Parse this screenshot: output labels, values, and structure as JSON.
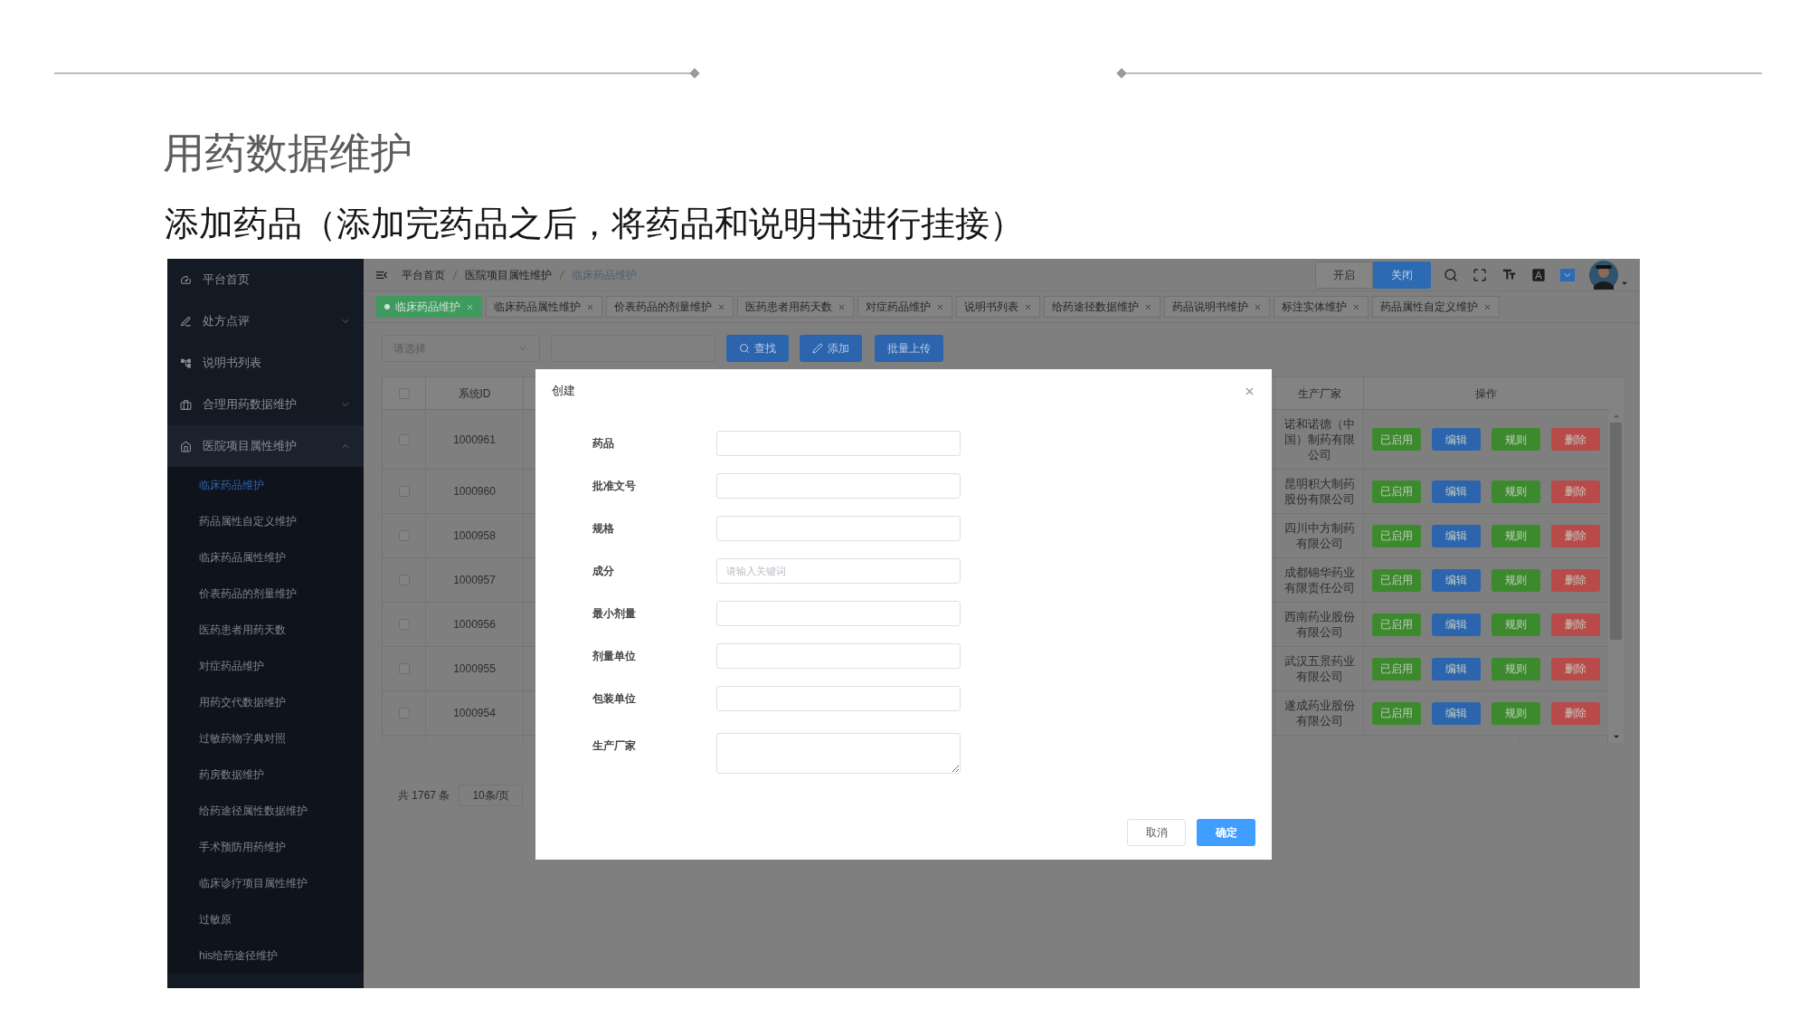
{
  "slide": {
    "title": "用药数据维护",
    "subtitle": "添加药品（添加完药品之后，将药品和说明书进行挂接）"
  },
  "sidebar": {
    "items": [
      {
        "label": "平台首页",
        "kind": "link"
      },
      {
        "label": "处方点评",
        "kind": "group",
        "expanded": false
      },
      {
        "label": "说明书列表",
        "kind": "link"
      },
      {
        "label": "合理用药数据维护",
        "kind": "group",
        "expanded": false
      },
      {
        "label": "医院项目属性维护",
        "kind": "group",
        "expanded": true,
        "children": [
          {
            "label": "临床药品维护",
            "selected": true
          },
          {
            "label": "药品属性自定义维护",
            "selected": false
          },
          {
            "label": "临床药品属性维护",
            "selected": false
          },
          {
            "label": "价表药品的剂量维护",
            "selected": false
          },
          {
            "label": "医药患者用药天数",
            "selected": false
          },
          {
            "label": "对症药品维护",
            "selected": false
          },
          {
            "label": "用药交代数据维护",
            "selected": false
          },
          {
            "label": "过敏药物字典对照",
            "selected": false
          },
          {
            "label": "药房数据维护",
            "selected": false
          },
          {
            "label": "给药途径属性数据维护",
            "selected": false
          },
          {
            "label": "手术预防用药维护",
            "selected": false
          },
          {
            "label": "临床诊疗项目属性维护",
            "selected": false
          },
          {
            "label": "过敏原",
            "selected": false
          },
          {
            "label": "his给药途径维护",
            "selected": false
          }
        ]
      }
    ]
  },
  "breadcrumb": [
    "平台首页",
    "医院项目属性维护",
    "临床药品维护"
  ],
  "toggle": [
    {
      "label": "开启",
      "selected": false
    },
    {
      "label": "关闭",
      "selected": true
    }
  ],
  "tabs": [
    {
      "label": "临床药品维护",
      "selected": true
    },
    {
      "label": "临床药品属性维护",
      "selected": false
    },
    {
      "label": "价表药品的剂量维护",
      "selected": false
    },
    {
      "label": "医药患者用药天数",
      "selected": false
    },
    {
      "label": "对症药品维护",
      "selected": false
    },
    {
      "label": "说明书列表",
      "selected": false
    },
    {
      "label": "给药途径数据维护",
      "selected": false
    },
    {
      "label": "药品说明书维护",
      "selected": false
    },
    {
      "label": "标注实体维护",
      "selected": false
    },
    {
      "label": "药品属性自定义维护",
      "selected": false
    }
  ],
  "toolbar": {
    "select_placeholder": "请选择",
    "buttons": [
      "查找",
      "添加",
      "批量上传"
    ]
  },
  "table": {
    "columns": [
      "系统ID",
      "生产厂家",
      "操作"
    ],
    "all_checked": false,
    "rows": [
      {
        "checked": false,
        "id": "1000961",
        "manufacturer": "诺和诺德（中国）制药有限公司",
        "actions": [
          {
            "label": "已启用",
            "color": "#3d8a2e"
          },
          {
            "label": "编辑",
            "color": "#2c65ad"
          },
          {
            "label": "规则",
            "color": "#3d8a2e"
          },
          {
            "label": "删除",
            "color": "#b84a4a"
          }
        ]
      },
      {
        "checked": false,
        "id": "1000960",
        "manufacturer": "昆明积大制药股份有限公司",
        "actions": [
          {
            "label": "已启用",
            "color": "#3d8a2e"
          },
          {
            "label": "编辑",
            "color": "#2c65ad"
          },
          {
            "label": "规则",
            "color": "#3d8a2e"
          },
          {
            "label": "删除",
            "color": "#b84a4a"
          }
        ]
      },
      {
        "checked": false,
        "id": "1000958",
        "manufacturer": "四川中方制药有限公司",
        "actions": [
          {
            "label": "已启用",
            "color": "#3d8a2e"
          },
          {
            "label": "编辑",
            "color": "#2c65ad"
          },
          {
            "label": "规则",
            "color": "#3d8a2e"
          },
          {
            "label": "删除",
            "color": "#b84a4a"
          }
        ]
      },
      {
        "checked": false,
        "id": "1000957",
        "manufacturer": "成都锦华药业有限责任公司",
        "actions": [
          {
            "label": "已启用",
            "color": "#3d8a2e"
          },
          {
            "label": "编辑",
            "color": "#2c65ad"
          },
          {
            "label": "规则",
            "color": "#3d8a2e"
          },
          {
            "label": "删除",
            "color": "#b84a4a"
          }
        ]
      },
      {
        "checked": false,
        "id": "1000956",
        "manufacturer": "西南药业股份有限公司",
        "actions": [
          {
            "label": "已启用",
            "color": "#3d8a2e"
          },
          {
            "label": "编辑",
            "color": "#2c65ad"
          },
          {
            "label": "规则",
            "color": "#3d8a2e"
          },
          {
            "label": "删除",
            "color": "#b84a4a"
          }
        ]
      },
      {
        "checked": false,
        "id": "1000955",
        "manufacturer": "武汉五景药业有限公司",
        "actions": [
          {
            "label": "已启用",
            "color": "#3d8a2e"
          },
          {
            "label": "编辑",
            "color": "#2c65ad"
          },
          {
            "label": "规则",
            "color": "#3d8a2e"
          },
          {
            "label": "删除",
            "color": "#b84a4a"
          }
        ]
      },
      {
        "checked": false,
        "id": "1000954",
        "manufacturer": "遂成药业股份有限公司",
        "actions": [
          {
            "label": "已启用",
            "color": "#3d8a2e"
          },
          {
            "label": "编辑",
            "color": "#2c65ad"
          },
          {
            "label": "规则",
            "color": "#3d8a2e"
          },
          {
            "label": "删除",
            "color": "#b84a4a"
          }
        ]
      }
    ]
  },
  "pagination": {
    "total": "共 1767 条",
    "page_size": "10条/页"
  },
  "dialog": {
    "title": "创建",
    "fields": [
      {
        "label": "药品",
        "kind": "input"
      },
      {
        "label": "批准文号",
        "kind": "input"
      },
      {
        "label": "规格",
        "kind": "input"
      },
      {
        "label": "成分",
        "kind": "input",
        "placeholder": "请输入关键词"
      },
      {
        "label": "最小剂量",
        "kind": "input"
      },
      {
        "label": "剂量单位",
        "kind": "input"
      },
      {
        "label": "包装单位",
        "kind": "input"
      },
      {
        "label": "生产厂家",
        "kind": "textarea"
      }
    ],
    "buttons": [
      {
        "label": "取消",
        "kind": "secondary"
      },
      {
        "label": "确定",
        "kind": "primary"
      }
    ]
  }
}
